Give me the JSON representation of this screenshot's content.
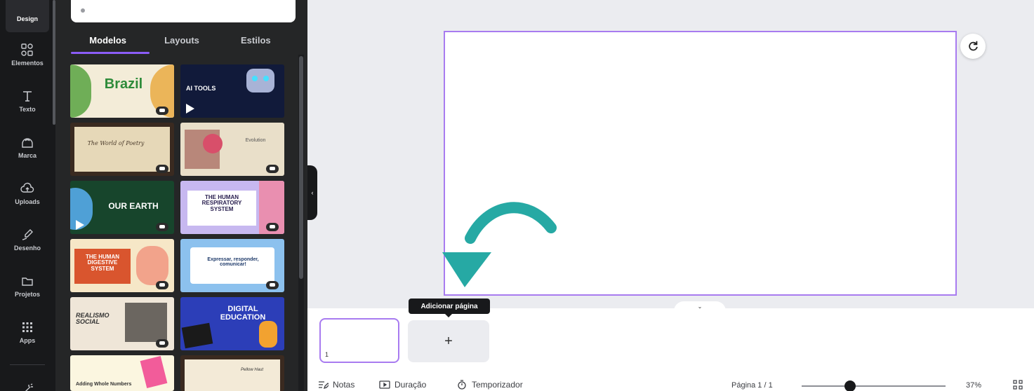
{
  "sidebar": {
    "items": [
      {
        "label": "Design",
        "icon": "design-icon"
      },
      {
        "label": "Elementos",
        "icon": "elements-icon"
      },
      {
        "label": "Texto",
        "icon": "text-icon"
      },
      {
        "label": "Marca",
        "icon": "brand-icon"
      },
      {
        "label": "Uploads",
        "icon": "upload-icon"
      },
      {
        "label": "Desenho",
        "icon": "draw-icon"
      },
      {
        "label": "Projetos",
        "icon": "folder-icon"
      },
      {
        "label": "Apps",
        "icon": "apps-icon"
      }
    ]
  },
  "panel": {
    "tabs": [
      "Modelos",
      "Layouts",
      "Estilos"
    ],
    "active_tab": "Modelos",
    "templates": [
      {
        "title": "Brazil",
        "bg": "#f3ecd8",
        "color": "#2e8b3a"
      },
      {
        "title": "AI TOOLS",
        "bg": "#111a3a",
        "color": "#ffffff"
      },
      {
        "title": "The World of Poetry",
        "bg": "#e6d8b8",
        "color": "#4a3a2a"
      },
      {
        "title": "Evolution",
        "bg": "#e9dfc9",
        "color": "#555555"
      },
      {
        "title": "OUR EARTH",
        "bg": "#17452c",
        "color": "#ffffff"
      },
      {
        "title": "THE HUMAN RESPIRATORY SYSTEM",
        "bg": "#c7b8f0",
        "color": "#2a2050"
      },
      {
        "title": "THE HUMAN DIGESTIVE SYSTEM",
        "bg": "#f6e7c7",
        "color": "#ffffff"
      },
      {
        "title": "Expressar, responder, comunicar!",
        "bg": "#8cc1ee",
        "color": "#1e3a6a"
      },
      {
        "title": "REALISMO SOCIAL",
        "bg": "#efe6d8",
        "color": "#333333"
      },
      {
        "title": "DIGITAL EDUCATION",
        "bg": "#2c3eb8",
        "color": "#ffffff"
      },
      {
        "title": "Adding Whole Numbers",
        "bg": "#fbf6e0",
        "color": "#333333"
      },
      {
        "title": "Pellow Haut",
        "bg": "#f3ead7",
        "color": "#333333"
      }
    ]
  },
  "editor": {
    "tooltip": "Adicionar página",
    "add_page_symbol": "+",
    "page_number": "1"
  },
  "bottombar": {
    "notes": "Notas",
    "duration": "Duração",
    "timer": "Temporizador",
    "page_indicator": "Página 1 / 1",
    "zoom": "37%"
  },
  "colors": {
    "accent": "#8b5cf6",
    "arrow": "#26a9a4",
    "canvas_border": "#a87bf0"
  }
}
